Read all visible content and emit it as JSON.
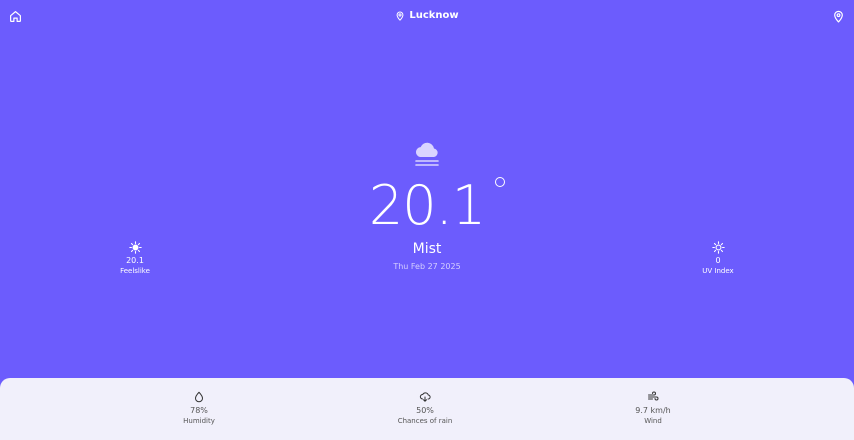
{
  "header": {
    "location": "Lucknow",
    "home_icon": "home-icon",
    "pin_icon": "map-pin-icon"
  },
  "current": {
    "condition_icon": "cloud-fog-icon",
    "temperature": "20.1",
    "condition": "Mist",
    "date": "Thu Feb 27 2025"
  },
  "side": {
    "feelslike": {
      "value": "20.1",
      "label": "Feelslike",
      "icon": "sun-icon"
    },
    "uv": {
      "value": "0",
      "label": "UV Index",
      "icon": "sun-icon"
    }
  },
  "details": [
    {
      "value": "78%",
      "label": "Humidity",
      "icon": "droplet-icon"
    },
    {
      "value": "50%",
      "label": "Chances of rain",
      "icon": "cloud-rain-icon"
    },
    {
      "value": "9.7 km/h",
      "label": "Wind",
      "icon": "wind-icon"
    }
  ],
  "colors": {
    "background": "#6c5cfd",
    "panel": "#f1f0fb",
    "text": "#ffffff"
  }
}
